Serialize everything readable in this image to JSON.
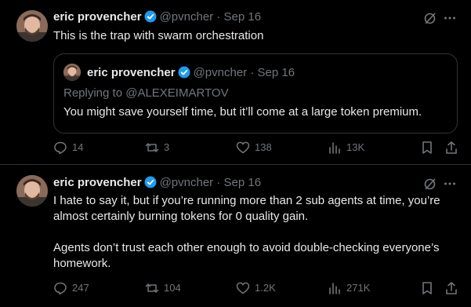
{
  "tweets": [
    {
      "author": {
        "name": "eric provencher",
        "handle": "@pvncher",
        "date": "Sep 16"
      },
      "separator": "·",
      "text": "This is the trap with swarm orchestration",
      "quote": {
        "author": {
          "name": "eric provencher",
          "handle": "@pvncher",
          "date": "Sep 16"
        },
        "separator": "·",
        "replying_to": "Replying to @ALEXEIMARTOV",
        "text": "You might save yourself time, but it’ll come at a large token premium."
      },
      "actions": {
        "replies": "14",
        "reposts": "3",
        "likes": "138",
        "views": "13K"
      }
    },
    {
      "author": {
        "name": "eric provencher",
        "handle": "@pvncher",
        "date": "Sep 16"
      },
      "separator": "·",
      "text_lines": [
        "I hate to say it, but if you’re running more than 2 sub agents at time, you’re",
        "almost certainly burning tokens for 0 quality gain.",
        "",
        "Agents don’t trust each other enough to avoid double-checking everyone’s",
        "homework."
      ],
      "actions": {
        "replies": "247",
        "reposts": "104",
        "likes": "1.2K",
        "views": "271K"
      }
    }
  ],
  "colors": {
    "background": "#000000",
    "text": "#e7e9ea",
    "muted": "#71767b",
    "verified": "#1d9bf0",
    "border": "#2f3336"
  },
  "icons": [
    "grok-icon",
    "more-icon",
    "reply-icon",
    "repost-icon",
    "like-icon",
    "views-icon",
    "bookmark-icon",
    "share-icon",
    "verified-badge-icon"
  ]
}
